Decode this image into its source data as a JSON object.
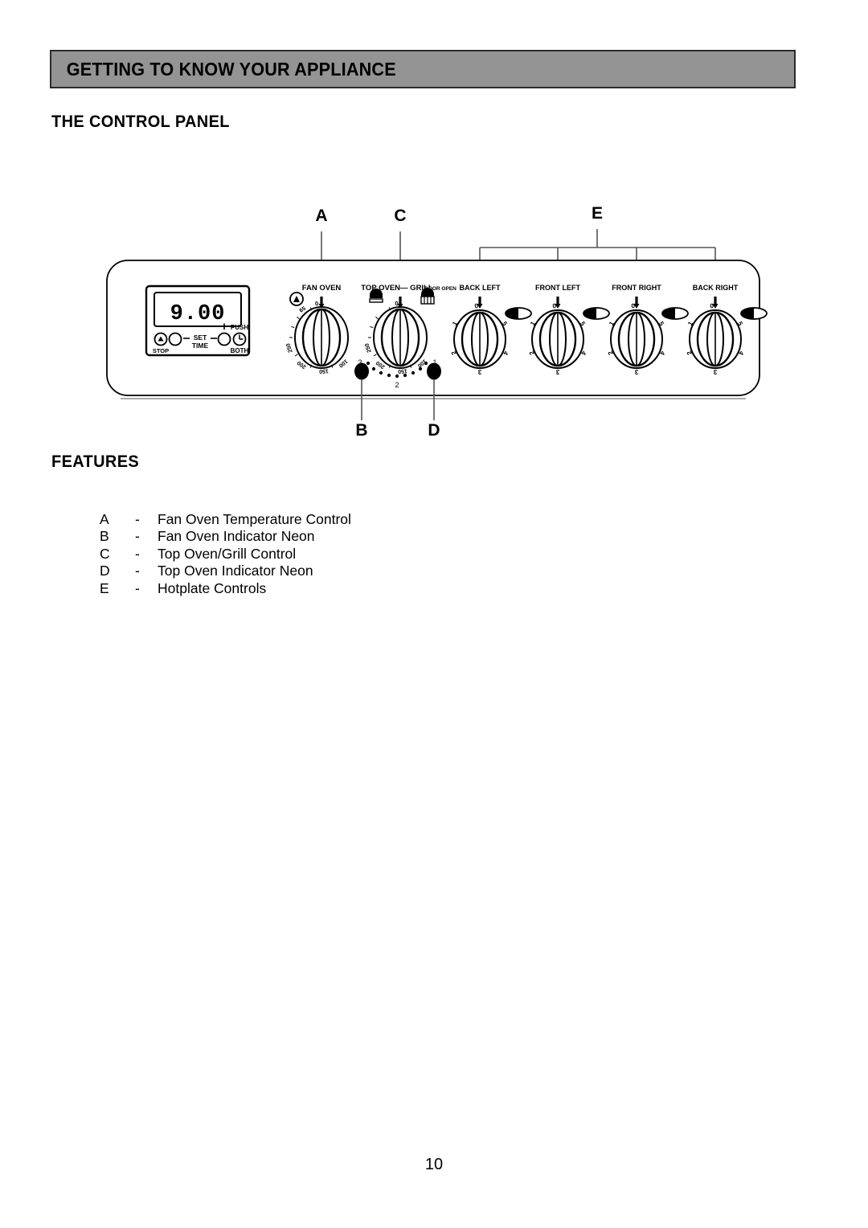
{
  "header": {
    "title": "GETTING TO KNOW YOUR APPLIANCE"
  },
  "sections": {
    "control_panel_heading": "THE CONTROL PANEL",
    "features_heading": "FEATURES"
  },
  "control_panel": {
    "timer": {
      "display_value": "9.00",
      "buttons": [
        {
          "name": "stop-button",
          "label": "STOP",
          "icon": "bell-icon"
        },
        {
          "name": "minus-button",
          "label": "–",
          "icon": "minus-icon"
        },
        {
          "name": "set-time-label",
          "label_top": "SET",
          "label_bottom": "TIME"
        },
        {
          "name": "plus-button",
          "label": "+",
          "icon": "plus-icon"
        },
        {
          "name": "push-both-button",
          "label_top": "PUSH",
          "label_bottom": "BOTH",
          "icon": "clock-icon"
        }
      ]
    },
    "knobs": [
      {
        "id": "fan-oven",
        "label": "FAN OVEN",
        "sublabel": "",
        "type": "oven-temperature",
        "symbol": "fan-symbol",
        "scale": [
          "0",
          "65",
          "100",
          "150",
          "200",
          "250"
        ]
      },
      {
        "id": "top-oven-grill",
        "label": "TOP OVEN— GRILL",
        "sublabel": "DOOR OPEN",
        "type": "oven-grill",
        "symbol": "grill-symbols",
        "scale": [
          "0",
          "100",
          "150",
          "200",
          "250"
        ],
        "grill_positions": [
          "1",
          "2",
          "3"
        ]
      },
      {
        "id": "back-left",
        "label": "BACK LEFT",
        "sublabel": "",
        "type": "hotplate",
        "scale": [
          "0",
          "1",
          "2",
          "3",
          "4",
          "5"
        ]
      },
      {
        "id": "front-left",
        "label": "FRONT LEFT",
        "sublabel": "",
        "type": "hotplate",
        "scale": [
          "0",
          "1",
          "2",
          "3",
          "4",
          "5"
        ]
      },
      {
        "id": "front-right",
        "label": "FRONT RIGHT",
        "sublabel": "",
        "type": "hotplate",
        "scale": [
          "0",
          "1",
          "2",
          "3",
          "4",
          "5"
        ]
      },
      {
        "id": "back-right",
        "label": "BACK RIGHT",
        "sublabel": "",
        "type": "hotplate",
        "scale": [
          "0",
          "1",
          "2",
          "3",
          "4",
          "5"
        ]
      }
    ],
    "callouts": [
      {
        "letter": "A",
        "target": "fan-oven-knob"
      },
      {
        "letter": "B",
        "target": "fan-oven-neon"
      },
      {
        "letter": "C",
        "target": "top-oven-grill-knob"
      },
      {
        "letter": "D",
        "target": "top-oven-neon"
      },
      {
        "letter": "E",
        "target": "hotplate-controls-group"
      }
    ]
  },
  "features": [
    {
      "letter": "A",
      "dash": "-",
      "text": "Fan Oven Temperature Control"
    },
    {
      "letter": "B",
      "dash": "-",
      "text": "Fan Oven Indicator Neon"
    },
    {
      "letter": "C",
      "dash": "-",
      "text": "Top Oven/Grill Control"
    },
    {
      "letter": "D",
      "dash": "-",
      "text": "Top Oven Indicator Neon"
    },
    {
      "letter": "E",
      "dash": "-",
      "text": "Hotplate Controls"
    }
  ],
  "footer": {
    "page_number": "10"
  },
  "colors": {
    "header_fill": "#949494",
    "header_border": "#2b2b2b",
    "ink": "#000000",
    "paper": "#ffffff"
  }
}
